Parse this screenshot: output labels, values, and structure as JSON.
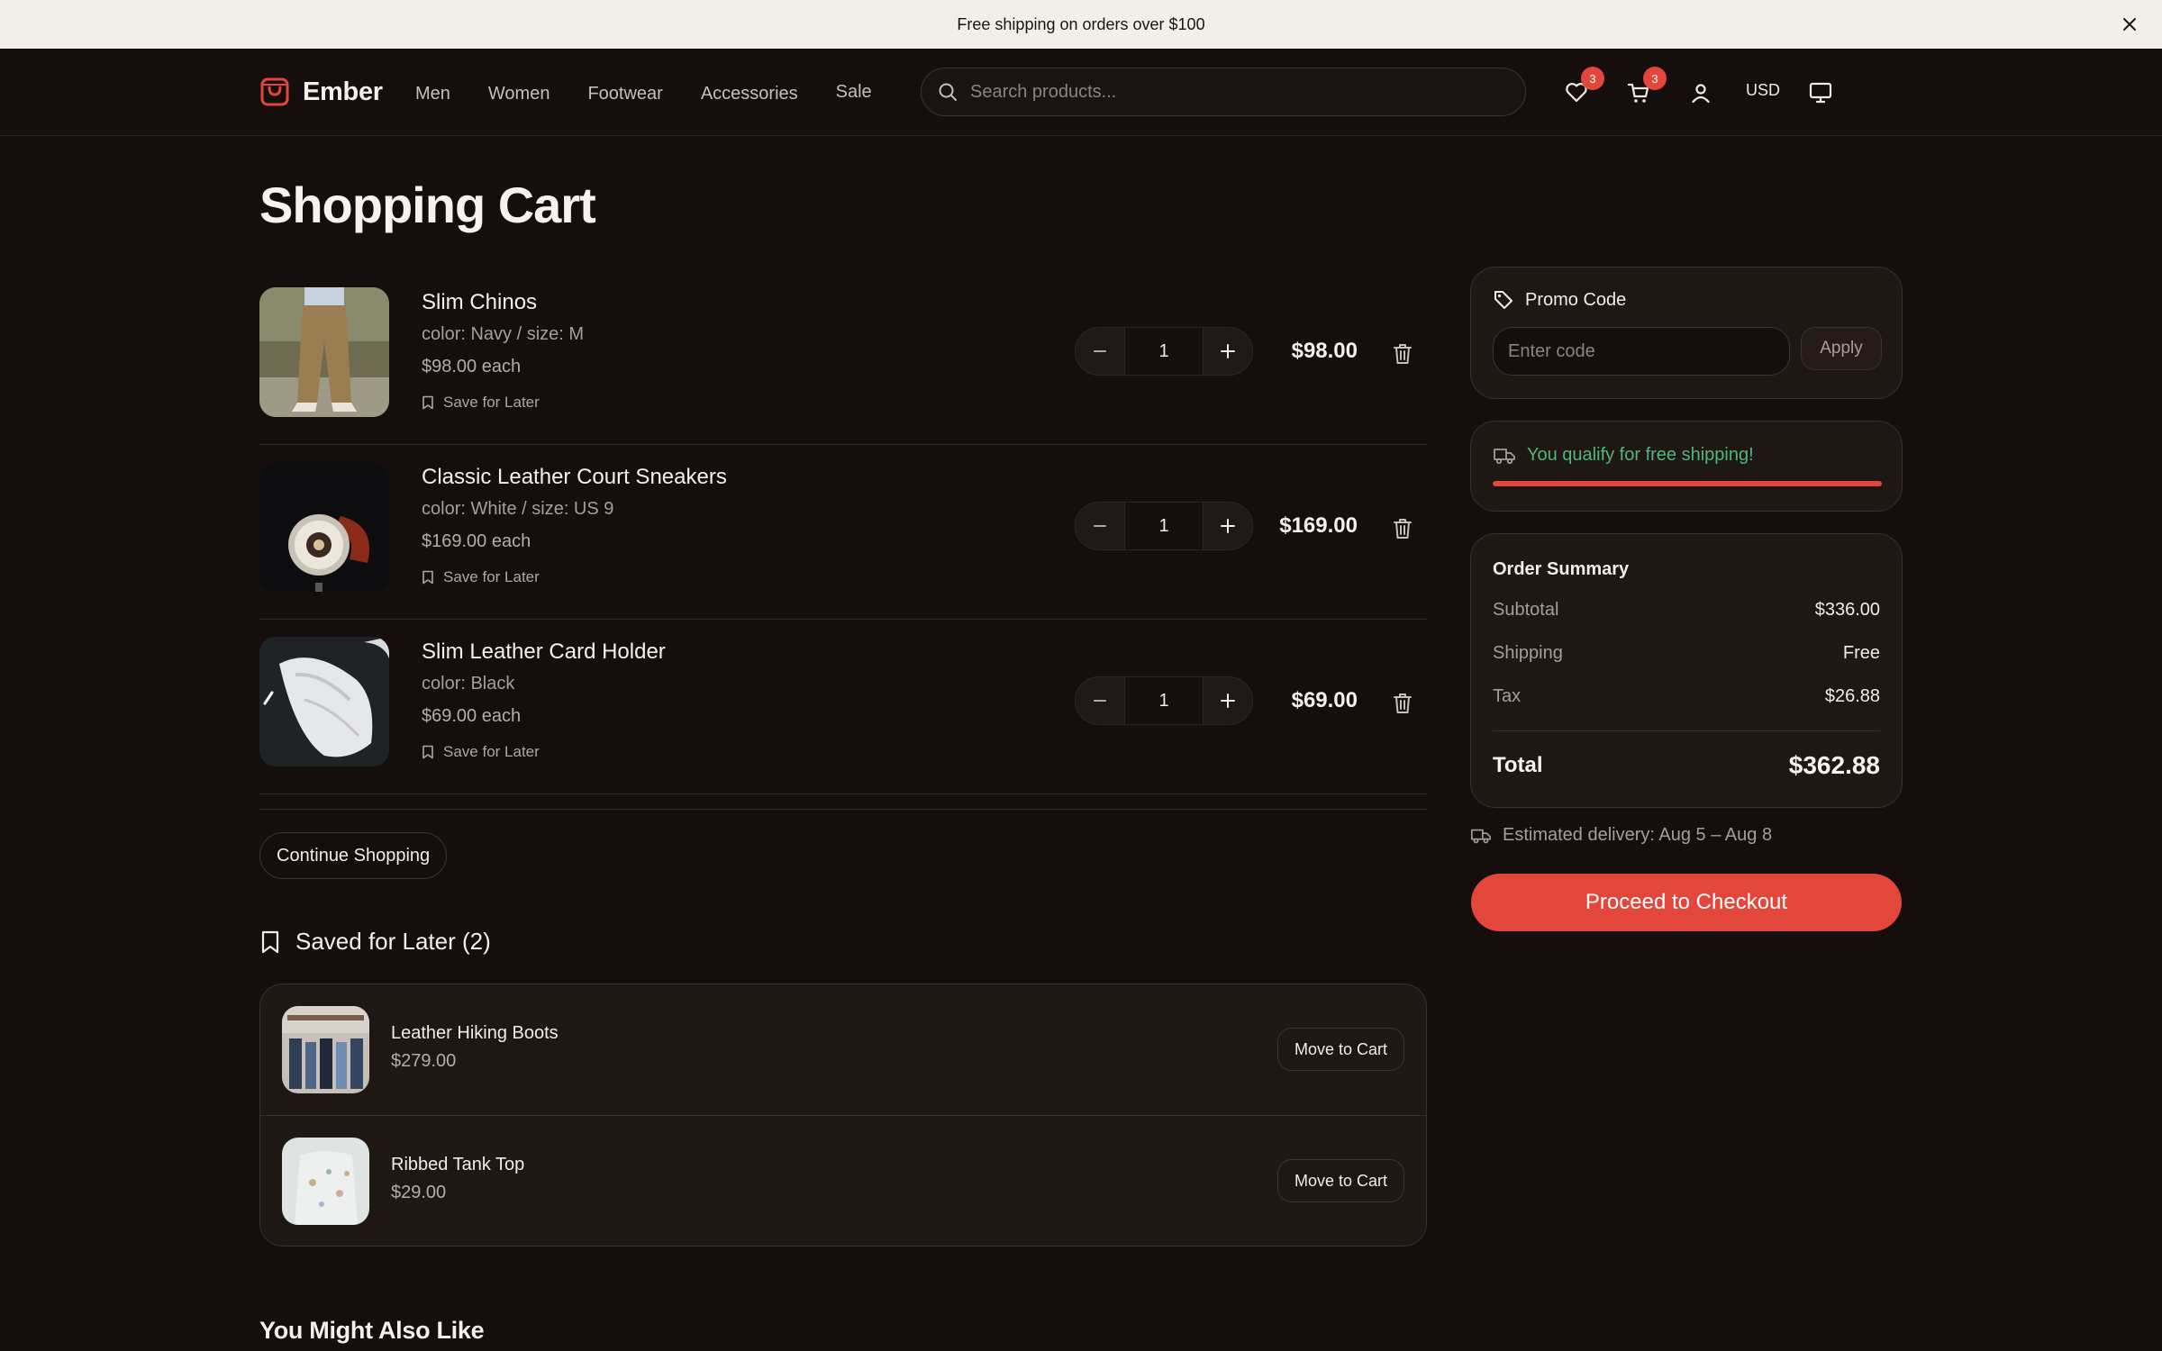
{
  "announcement": {
    "text": "Free shipping on orders over $100"
  },
  "header": {
    "logo": "Ember",
    "nav": [
      "Men",
      "Women",
      "Footwear",
      "Accessories",
      "Sale"
    ],
    "search_placeholder": "Search products...",
    "wishlist_count": "3",
    "cart_count": "3",
    "currency": "USD"
  },
  "page": {
    "title": "Shopping Cart"
  },
  "cart": {
    "items": [
      {
        "name": "Slim Chinos",
        "variant": "color: Navy / size: M",
        "each": "$98.00 each",
        "save_label": "Save for Later",
        "qty": "1",
        "total": "$98.00"
      },
      {
        "name": "Classic Leather Court Sneakers",
        "variant": "color: White / size: US 9",
        "each": "$169.00 each",
        "save_label": "Save for Later",
        "qty": "1",
        "total": "$169.00"
      },
      {
        "name": "Slim Leather Card Holder",
        "variant": "color: Black",
        "each": "$69.00 each",
        "save_label": "Save for Later",
        "qty": "1",
        "total": "$69.00"
      }
    ],
    "continue_label": "Continue Shopping"
  },
  "saved": {
    "title": "Saved for Later (2)",
    "items": [
      {
        "name": "Leather Hiking Boots",
        "price": "$279.00",
        "button": "Move to Cart"
      },
      {
        "name": "Ribbed Tank Top",
        "price": "$29.00",
        "button": "Move to Cart"
      }
    ]
  },
  "recommendations": {
    "title": "You Might Also Like"
  },
  "promo": {
    "title": "Promo Code",
    "placeholder": "Enter code",
    "apply_label": "Apply"
  },
  "shipping_progress": {
    "message": "You qualify for free shipping!",
    "progress": 1.0
  },
  "summary": {
    "title": "Order Summary",
    "subtotal_label": "Subtotal",
    "subtotal": "$336.00",
    "shipping_label": "Shipping",
    "shipping": "Free",
    "tax_label": "Tax",
    "tax": "$26.88",
    "total_label": "Total",
    "total": "$362.88"
  },
  "delivery": {
    "text": "Estimated delivery: Aug 5 – Aug 8"
  },
  "checkout": {
    "label": "Proceed to Checkout"
  },
  "colors": {
    "accent": "#e3473b",
    "success": "#4fb77d",
    "background": "#150e0c",
    "card": "#1e1714"
  },
  "icons": [
    "close-icon",
    "shopping-bag-icon",
    "search-icon",
    "heart-icon",
    "cart-icon",
    "user-icon",
    "monitor-icon",
    "bookmark-icon",
    "minus-icon",
    "plus-icon",
    "trash-icon",
    "tag-icon",
    "truck-icon"
  ]
}
